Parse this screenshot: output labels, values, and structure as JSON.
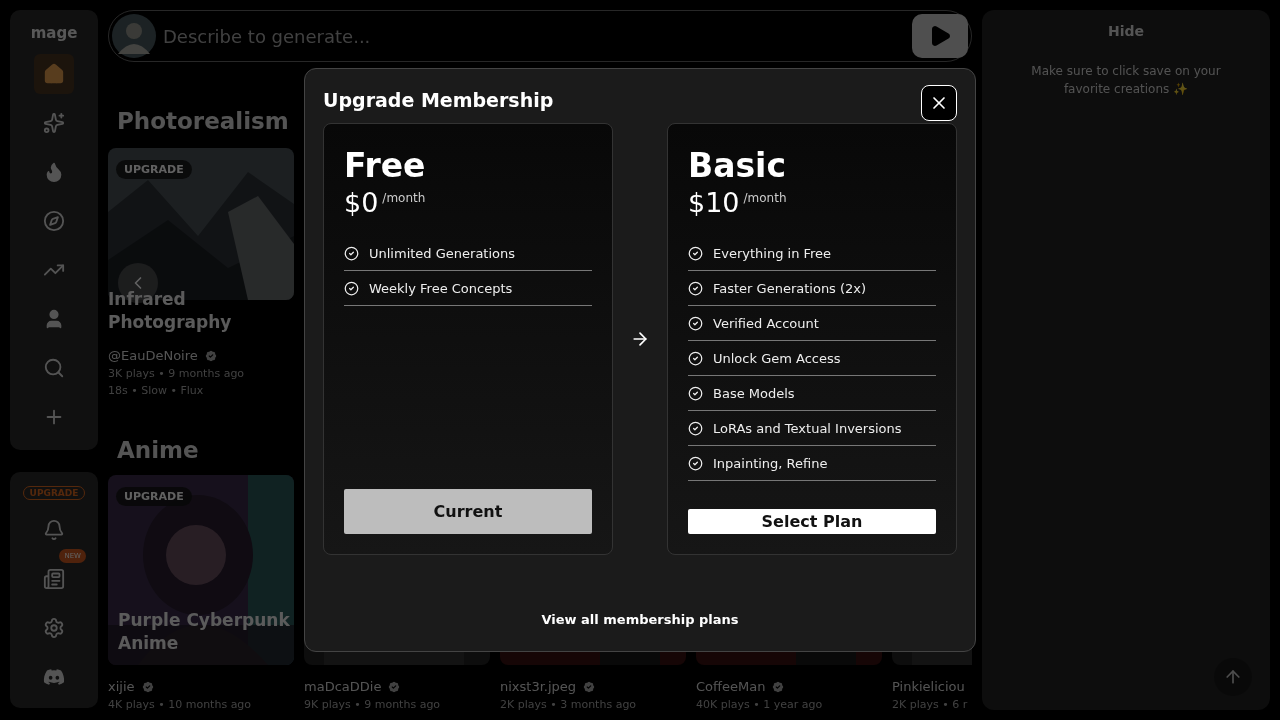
{
  "sidebar": {
    "logo": "mage",
    "nav": [
      {
        "selected": true
      },
      {
        "selected": false
      },
      {
        "selected": false
      },
      {
        "selected": false
      },
      {
        "selected": false
      },
      {
        "selected": false
      },
      {
        "selected": false
      },
      {
        "selected": false
      }
    ],
    "upgrade_badge": "UPGRADE",
    "new_badge": "NEW"
  },
  "prompt": {
    "placeholder": "Describe to generate..."
  },
  "sections": [
    {
      "title": "Photorealism",
      "cards": [
        {
          "badge": "UPGRADE",
          "title": "Infrared Photography",
          "author": "@EauDeNoire",
          "stats": "3K plays • 9 months ago",
          "details": "18s • Slow • Flux"
        }
      ]
    },
    {
      "title": "Anime",
      "cards": [
        {
          "badge": "UPGRADE",
          "title": "Purple Cyberpunk Anime",
          "author": "xijie",
          "stats": "4K plays • 10 months ago"
        },
        {
          "author": "maDcaDDie",
          "stats": "9K plays • 9 months ago"
        },
        {
          "author": "nixst3r.jpeg",
          "stats": "2K plays • 3 months ago"
        },
        {
          "author": "CoffeeMan",
          "stats": "40K plays • 1 year ago"
        },
        {
          "author": "Pinkieliciou",
          "stats": "2K plays • 6 r"
        }
      ]
    }
  ],
  "side_panel": {
    "title": "Hide",
    "message": "Make sure to click save on your favorite creations ✨"
  },
  "modal": {
    "title": "Upgrade Membership",
    "plans": [
      {
        "name": "Free",
        "price": "$0",
        "period": "/month",
        "features": [
          "Unlimited Generations",
          "Weekly Free Concepts"
        ],
        "button": "Current",
        "current": true
      },
      {
        "name": "Basic",
        "price": "$10",
        "period": "/month",
        "features": [
          "Everything in Free",
          "Faster Generations (2x)",
          "Verified Account",
          "Unlock Gem Access",
          "Base Models",
          "LoRAs and Textual Inversions",
          "Inpainting, Refine"
        ],
        "button": "Select Plan",
        "current": false
      }
    ],
    "link": "View all membership plans"
  }
}
